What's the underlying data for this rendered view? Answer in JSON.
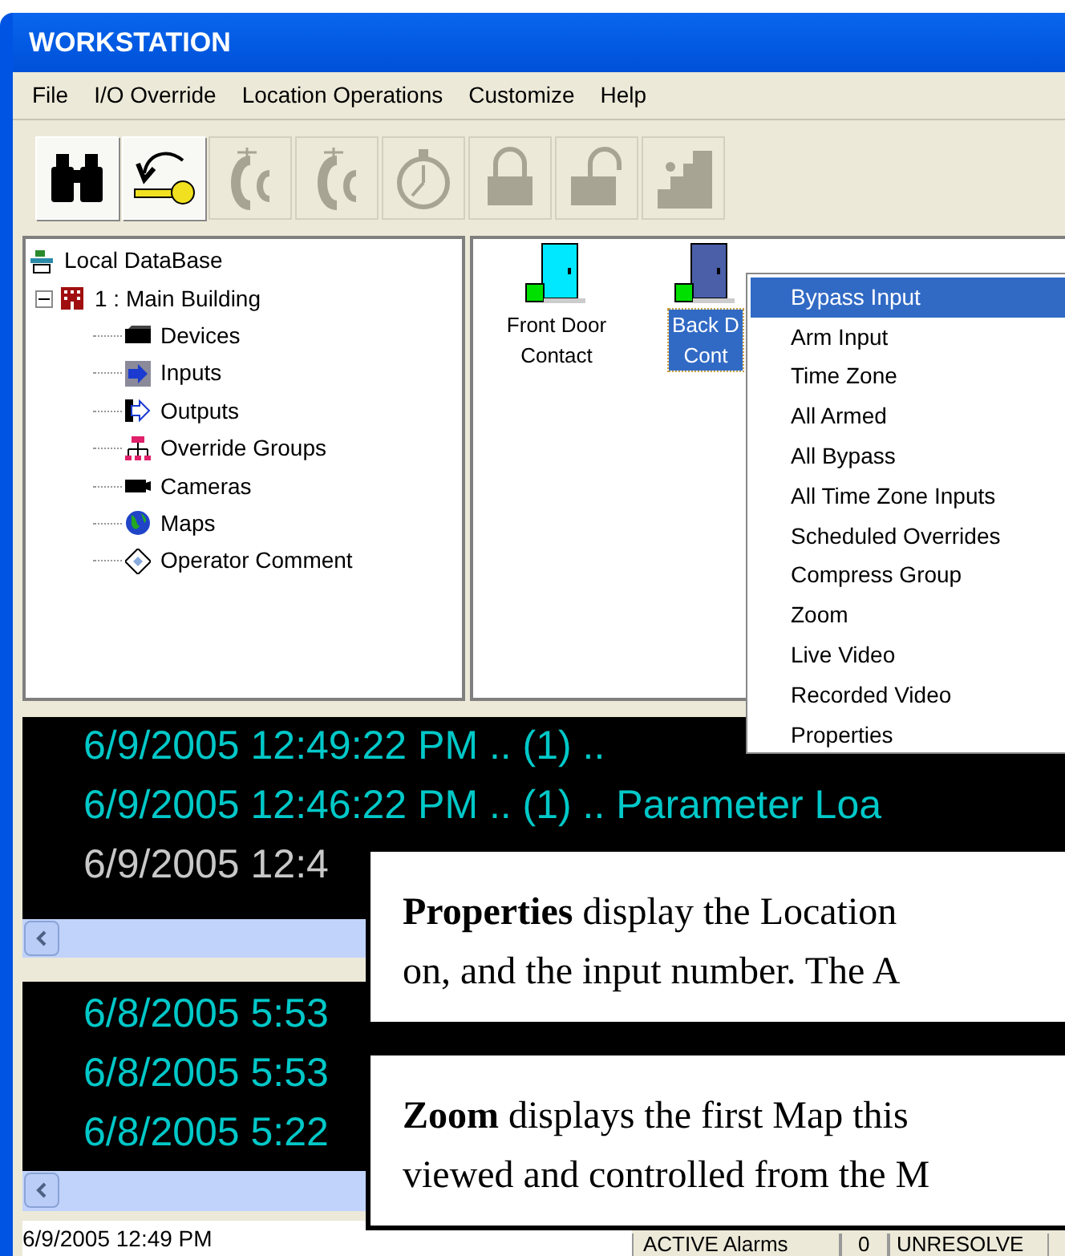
{
  "window": {
    "title": "WORKSTATION"
  },
  "menu": [
    "File",
    "I/O Override",
    "Location Operations",
    "Customize",
    "Help"
  ],
  "toolbar": [
    {
      "kind": "binoculars",
      "disabled": false
    },
    {
      "kind": "key",
      "disabled": false
    },
    {
      "kind": "figure",
      "disabled": true
    },
    {
      "kind": "figure",
      "disabled": true
    },
    {
      "kind": "stopwatch",
      "disabled": true
    },
    {
      "kind": "lock",
      "disabled": true
    },
    {
      "kind": "unlock",
      "disabled": true
    },
    {
      "kind": "exit",
      "disabled": true
    }
  ],
  "tree": {
    "label": "Local DataBase",
    "kind": "database",
    "children": [
      {
        "label": "1 : Main Building",
        "kind": "building",
        "expanded": true,
        "children": [
          {
            "label": "Devices",
            "kind": "device"
          },
          {
            "label": "Inputs",
            "kind": "input"
          },
          {
            "label": "Outputs",
            "kind": "output"
          },
          {
            "label": "Override Groups",
            "kind": "group"
          },
          {
            "label": "Cameras",
            "kind": "camera"
          },
          {
            "label": "Maps",
            "kind": "globe"
          },
          {
            "label": "Operator Comment",
            "kind": "comment"
          }
        ]
      }
    ]
  },
  "inputs": [
    {
      "lines": [
        "Front Door",
        "Contact"
      ],
      "selected": false
    },
    {
      "lines": [
        "Back D",
        "Cont"
      ],
      "selected": true
    }
  ],
  "context_menu": [
    {
      "label": "Bypass Input",
      "selected": true
    },
    {
      "label": "Arm Input",
      "selected": false
    },
    {
      "label": "Time Zone",
      "selected": false
    },
    {
      "label": "All Armed",
      "selected": false
    },
    {
      "label": "All Bypass",
      "selected": false
    },
    {
      "label": "All Time Zone Inputs",
      "selected": false
    },
    {
      "label": "Scheduled Overrides",
      "selected": false
    },
    {
      "label": "Compress Group",
      "selected": false
    },
    {
      "label": "Zoom",
      "selected": false
    },
    {
      "label": "Live Video",
      "selected": false
    },
    {
      "label": "Recorded Video",
      "selected": false
    },
    {
      "label": "Properties",
      "selected": false
    }
  ],
  "event_log": [
    {
      "text": "6/9/2005 12:49:22 PM .. (1) ..",
      "color": "#00c8c8"
    },
    {
      "text": "6/9/2005 12:46:22 PM .. (1) .. Parameter Loa",
      "color": "#00c8c8"
    },
    {
      "text": "6/9/2005 12:4",
      "color": "#c8c8c8"
    }
  ],
  "alarm_log": [
    {
      "text": "6/8/2005 5:53",
      "color": "#00c8c8"
    },
    {
      "text": "6/8/2005 5:53",
      "color": "#00c8c8"
    },
    {
      "text": "6/8/2005 5:22",
      "color": "#00c8c8"
    }
  ],
  "status_bar": {
    "time": "6/9/2005 12:49 PM",
    "alarms_label": "ACTIVE Alarms",
    "alarms_count": "0",
    "column_3": "UNRESOLVE"
  },
  "callouts": [
    {
      "lines": [
        "**Properties** display the Location",
        "on, and the input number. The A"
      ]
    },
    {
      "lines": [
        "**Zoom** displays the first Map this",
        "viewed and controlled from the M"
      ]
    }
  ]
}
